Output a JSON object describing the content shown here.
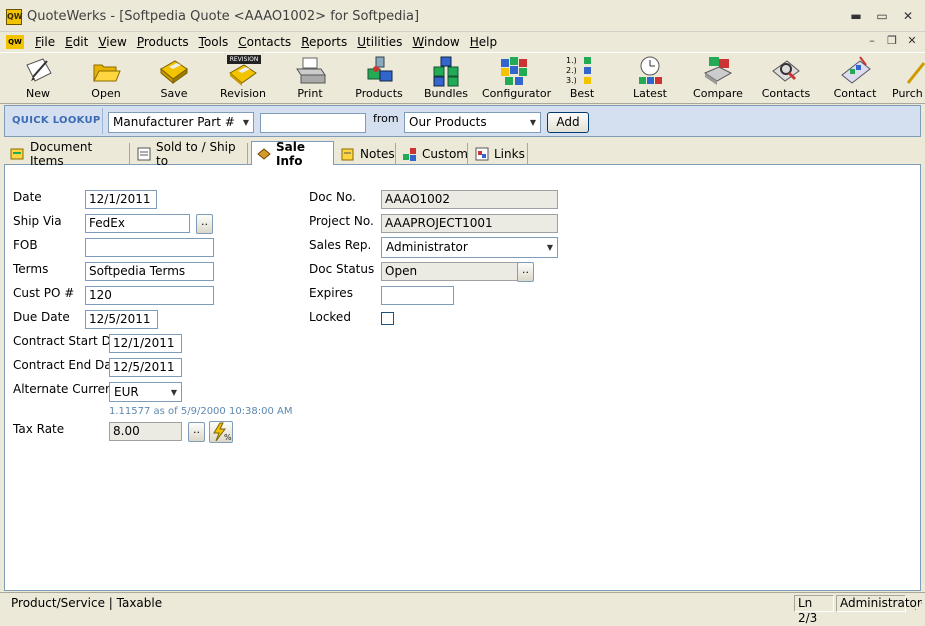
{
  "window": {
    "title": "QuoteWerks - [Softpedia Quote <AAAO1002> for Softpedia]",
    "app_icon_text": "QW"
  },
  "menu": {
    "items": [
      "File",
      "Edit",
      "View",
      "Products",
      "Tools",
      "Contacts",
      "Reports",
      "Utilities",
      "Window",
      "Help"
    ]
  },
  "toolbar": {
    "buttons": [
      {
        "label": "New",
        "icon": "new-document-icon"
      },
      {
        "label": "Open",
        "icon": "open-folder-icon"
      },
      {
        "label": "Save",
        "icon": "save-disk-icon"
      },
      {
        "label": "Revision",
        "icon": "revision-icon",
        "badge": "REVISION"
      },
      {
        "label": "Print",
        "icon": "printer-icon"
      },
      {
        "label": "Products",
        "icon": "products-icon"
      },
      {
        "label": "Bundles",
        "icon": "bundles-icon"
      },
      {
        "label": "Configurator",
        "icon": "configurator-icon"
      },
      {
        "label": "Best",
        "icon": "best-list-icon",
        "list": [
          "1.)",
          "2.)",
          "3.)"
        ]
      },
      {
        "label": "Latest",
        "icon": "clock-icon"
      },
      {
        "label": "Compare",
        "icon": "compare-icon"
      },
      {
        "label": "Contacts",
        "icon": "contacts-icon"
      },
      {
        "label": "Contact",
        "icon": "contact-card-icon"
      },
      {
        "label": "Purch",
        "icon": "purchase-icon"
      }
    ]
  },
  "quick_lookup": {
    "label": "QUICK LOOKUP",
    "field_select": "Manufacturer Part #",
    "search_value": "",
    "from_label": "from",
    "source_select": "Our Products",
    "add_label": "Add"
  },
  "tabs": [
    {
      "label": "Document Items",
      "icon": "document-items-icon"
    },
    {
      "label": "Sold to / Ship to",
      "icon": "sold-to-icon"
    },
    {
      "label": "Sale Info",
      "icon": "sale-info-icon",
      "active": true
    },
    {
      "label": "Notes",
      "icon": "notes-icon"
    },
    {
      "label": "Custom",
      "icon": "custom-icon"
    },
    {
      "label": "Links",
      "icon": "links-icon"
    }
  ],
  "sale_info": {
    "date": {
      "label": "Date",
      "value": "12/1/2011"
    },
    "ship_via": {
      "label": "Ship Via",
      "value": "FedEx",
      "browse": ".."
    },
    "fob": {
      "label": "FOB",
      "value": ""
    },
    "terms": {
      "label": "Terms",
      "value": "Softpedia Terms"
    },
    "cust_po": {
      "label": "Cust PO #",
      "value": "120"
    },
    "due_date": {
      "label": "Due Date",
      "value": "12/5/2011"
    },
    "contract_start": {
      "label": "Contract Start Date",
      "value": "12/1/2011"
    },
    "contract_end": {
      "label": "Contract End Date",
      "value": "12/5/2011"
    },
    "alt_currency": {
      "label": "Alternate Currency",
      "value": "EUR",
      "rate_note": "1.11577 as of 5/9/2000 10:38:00 AM"
    },
    "tax_rate": {
      "label": "Tax Rate",
      "value": "8.00",
      "browse": ".."
    },
    "doc_no": {
      "label": "Doc No.",
      "value": "AAAO1002"
    },
    "project_no": {
      "label": "Project No.",
      "value": "AAAPROJECT1001"
    },
    "sales_rep": {
      "label": "Sales Rep.",
      "value": "Administrator"
    },
    "doc_status": {
      "label": "Doc Status",
      "value": "Open",
      "browse": ".."
    },
    "expires": {
      "label": "Expires",
      "value": ""
    },
    "locked": {
      "label": "Locked",
      "checked": false
    }
  },
  "status_bar": {
    "left": "Product/Service | Taxable",
    "line": "Ln 2/3",
    "user": "Administrator"
  },
  "colors": {
    "window_bg": "#ece9d8",
    "lookup_bg": "#d4dff0",
    "lookup_label": "#3b6bb5",
    "field_border": "#7f9db9",
    "rate_note": "#5e88b0"
  }
}
